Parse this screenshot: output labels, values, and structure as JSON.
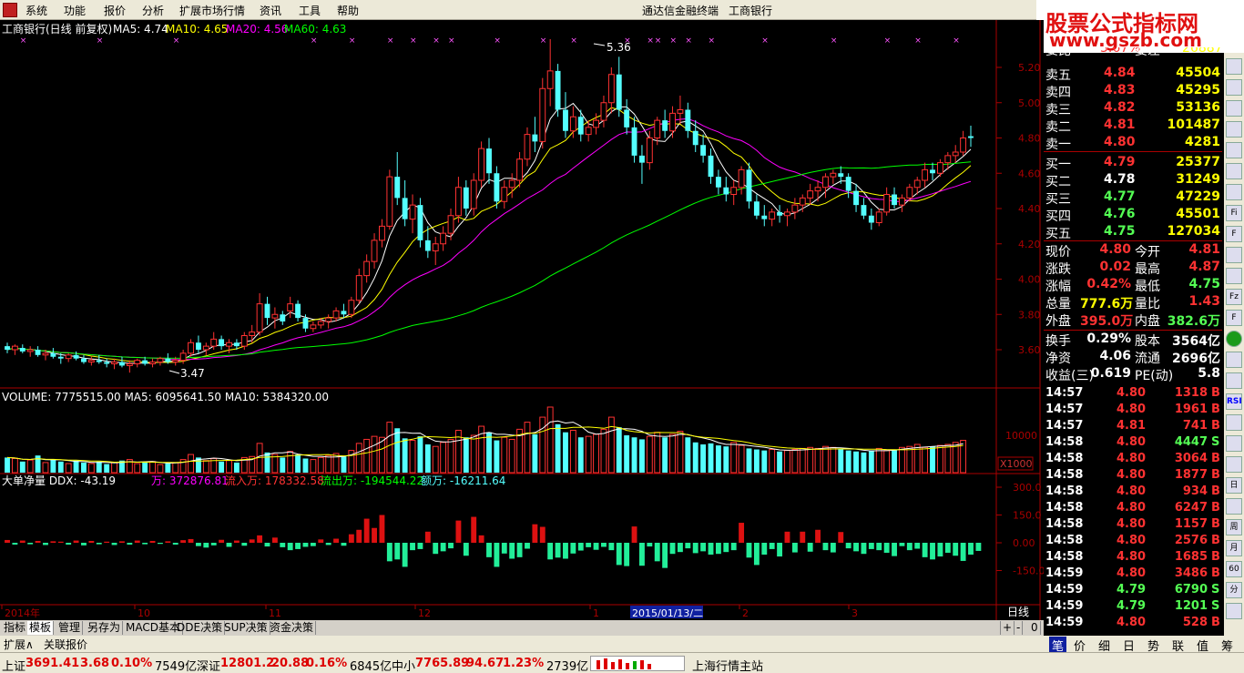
{
  "menu": {
    "items": [
      "系统",
      "功能",
      "报价",
      "分析",
      "扩展市场行情",
      "资讯",
      "工具",
      "帮助"
    ],
    "window_title": "通达信金融终端",
    "stock_title": "工商银行"
  },
  "logo": {
    "line1": "股票公式指标网",
    "line2": "www.gszb.com"
  },
  "colors": {
    "up": "#ff3232",
    "down": "#54ffff",
    "ma5": "#ffffff",
    "ma10": "#ffff00",
    "ma20": "#ff00ff",
    "ma60": "#00ff00",
    "axis": "#aa0000"
  },
  "main_panel": {
    "label_name": "工商银行(日线 前复权)",
    "ma5": "MA5: 4.74",
    "ma10": "MA10: 4.65",
    "ma20": "MA20: 4.56",
    "ma60": "MA60: 4.63",
    "high_note": "5.36",
    "low_note": "3.47",
    "y_ticks": [
      "5.20",
      "5.00",
      "4.80",
      "4.60",
      "4.40",
      "4.20",
      "4.00",
      "3.80",
      "3.60"
    ]
  },
  "volume_panel": {
    "label": "VOLUME: 7775515.00  MA5: 6095641.50  MA10: 5384320.00",
    "y_tick": "10000",
    "unit": "X1000"
  },
  "ddx_panel": {
    "label": "大单净量  DDX: -43.19",
    "extra_wan": "万: 372876.81",
    "extra_in": "流入万: 178332.58",
    "extra_out": "流出万: -194544.22",
    "extra_net": "额万: -16211.64",
    "y_ticks": [
      "300.0",
      "150.0",
      "0.00",
      "-150.0"
    ]
  },
  "x_axis": {
    "labels": [
      "2014年",
      "10",
      "11",
      "12",
      "1",
      "2",
      "3"
    ],
    "cursor_date": "2015/01/13/二",
    "period": "日线"
  },
  "quote": {
    "top_partial": [
      "委比",
      "3.67%",
      "委差",
      "26887"
    ],
    "asks": [
      {
        "label": "卖五",
        "price": "4.84",
        "vol": "45504"
      },
      {
        "label": "卖四",
        "price": "4.83",
        "vol": "45295"
      },
      {
        "label": "卖三",
        "price": "4.82",
        "vol": "53136"
      },
      {
        "label": "卖二",
        "price": "4.81",
        "vol": "101487"
      },
      {
        "label": "卖一",
        "price": "4.80",
        "vol": "4281"
      }
    ],
    "bids": [
      {
        "label": "买一",
        "price": "4.79",
        "vol": "25377"
      },
      {
        "label": "买二",
        "price": "4.78",
        "vol": "31249"
      },
      {
        "label": "买三",
        "price": "4.77",
        "vol": "47229"
      },
      {
        "label": "买四",
        "price": "4.76",
        "vol": "45501"
      },
      {
        "label": "买五",
        "price": "4.75",
        "vol": "127034"
      }
    ],
    "stats": [
      {
        "l1": "现价",
        "v1": "4.80",
        "l2": "今开",
        "v2": "4.81"
      },
      {
        "l1": "涨跌",
        "v1": "0.02",
        "l2": "最高",
        "v2": "4.87"
      },
      {
        "l1": "涨幅",
        "v1": "0.42%",
        "l2": "最低",
        "v2": "4.75"
      },
      {
        "l1": "总量",
        "v1": "777.6万",
        "l2": "量比",
        "v2": "1.43"
      },
      {
        "l1": "外盘",
        "v1": "395.0万",
        "l2": "内盘",
        "v2": "382.6万"
      }
    ],
    "stats2": [
      {
        "l1": "换手",
        "v1": "0.29%",
        "l2": "股本",
        "v2": "3564亿"
      },
      {
        "l1": "净资",
        "v1": "4.06",
        "l2": "流通",
        "v2": "2696亿"
      },
      {
        "l1": "收益(三)",
        "v1": "0.619",
        "l2": "PE(动)",
        "v2": "5.8"
      }
    ]
  },
  "ticks": [
    {
      "t": "14:57",
      "p": "4.80",
      "v": "1318",
      "d": "B"
    },
    {
      "t": "14:57",
      "p": "4.80",
      "v": "1961",
      "d": "B"
    },
    {
      "t": "14:57",
      "p": "4.81",
      "v": "741",
      "d": "B"
    },
    {
      "t": "14:58",
      "p": "4.80",
      "v": "4447",
      "d": "S"
    },
    {
      "t": "14:58",
      "p": "4.80",
      "v": "3064",
      "d": "B"
    },
    {
      "t": "14:58",
      "p": "4.80",
      "v": "1877",
      "d": "B"
    },
    {
      "t": "14:58",
      "p": "4.80",
      "v": "934",
      "d": "B"
    },
    {
      "t": "14:58",
      "p": "4.80",
      "v": "6247",
      "d": "B"
    },
    {
      "t": "14:58",
      "p": "4.80",
      "v": "1157",
      "d": "B"
    },
    {
      "t": "14:58",
      "p": "4.80",
      "v": "2576",
      "d": "B"
    },
    {
      "t": "14:58",
      "p": "4.80",
      "v": "1685",
      "d": "B"
    },
    {
      "t": "14:59",
      "p": "4.80",
      "v": "3486",
      "d": "B"
    },
    {
      "t": "14:59",
      "p": "4.79",
      "v": "6790",
      "d": "S"
    },
    {
      "t": "14:59",
      "p": "4.79",
      "v": "1201",
      "d": "S"
    },
    {
      "t": "14:59",
      "p": "4.80",
      "v": "528",
      "d": "B"
    }
  ],
  "right_toolbar": [
    "RSI"
  ],
  "bottom_tabs": [
    "指标",
    "模板",
    "管理",
    "另存为",
    "MACD基本",
    "DDE决策",
    "SUP决策",
    "资金决策"
  ],
  "bottom_right_ctrl": [
    "+",
    "-",
    "0"
  ],
  "ext_bar": {
    "a": "扩展∧",
    "b": "关联报价"
  },
  "right_tabs": [
    "笔",
    "价",
    "细",
    "日",
    "势",
    "联",
    "值",
    "筹"
  ],
  "status": {
    "sh_name": "上证",
    "sh_val": "3691.41",
    "sh_chg": "3.68",
    "sh_pct": "0.10%",
    "sh_amt": "7549亿",
    "sz_name": "深证",
    "sz_val": "12801.2",
    "sz_chg": "20.88",
    "sz_pct": "0.16%",
    "sz_amt": "6845亿",
    "zx_name": "中小",
    "zx_val": "7765.89",
    "zx_chg": "94.67",
    "zx_pct": "1.23%",
    "zx_amt": "2739亿",
    "server": "上海行情主站"
  },
  "chart_data": {
    "type": "candlestick",
    "title": "工商银行(日线 前复权)",
    "y_range": [
      3.47,
      5.36
    ],
    "candles": [
      [
        3.62,
        3.64,
        3.58,
        3.6
      ],
      [
        3.6,
        3.63,
        3.57,
        3.62
      ],
      [
        3.61,
        3.63,
        3.58,
        3.59
      ],
      [
        3.59,
        3.62,
        3.56,
        3.6
      ],
      [
        3.6,
        3.62,
        3.56,
        3.57
      ],
      [
        3.57,
        3.6,
        3.54,
        3.58
      ],
      [
        3.58,
        3.61,
        3.55,
        3.56
      ],
      [
        3.56,
        3.58,
        3.52,
        3.55
      ],
      [
        3.55,
        3.58,
        3.53,
        3.57
      ],
      [
        3.57,
        3.59,
        3.54,
        3.55
      ],
      [
        3.55,
        3.57,
        3.52,
        3.53
      ],
      [
        3.53,
        3.56,
        3.51,
        3.54
      ],
      [
        3.54,
        3.57,
        3.52,
        3.53
      ],
      [
        3.53,
        3.55,
        3.5,
        3.52
      ],
      [
        3.52,
        3.55,
        3.49,
        3.53
      ],
      [
        3.53,
        3.56,
        3.5,
        3.51
      ],
      [
        3.51,
        3.54,
        3.47,
        3.52
      ],
      [
        3.52,
        3.55,
        3.5,
        3.54
      ],
      [
        3.54,
        3.56,
        3.51,
        3.52
      ],
      [
        3.52,
        3.55,
        3.5,
        3.53
      ],
      [
        3.53,
        3.56,
        3.51,
        3.55
      ],
      [
        3.55,
        3.58,
        3.52,
        3.53
      ],
      [
        3.53,
        3.56,
        3.51,
        3.54
      ],
      [
        3.54,
        3.6,
        3.52,
        3.58
      ],
      [
        3.58,
        3.66,
        3.56,
        3.64
      ],
      [
        3.64,
        3.68,
        3.58,
        3.6
      ],
      [
        3.6,
        3.64,
        3.57,
        3.62
      ],
      [
        3.62,
        3.7,
        3.6,
        3.66
      ],
      [
        3.66,
        3.68,
        3.6,
        3.62
      ],
      [
        3.62,
        3.66,
        3.58,
        3.64
      ],
      [
        3.64,
        3.66,
        3.6,
        3.62
      ],
      [
        3.62,
        3.7,
        3.6,
        3.68
      ],
      [
        3.68,
        3.74,
        3.64,
        3.7
      ],
      [
        3.7,
        3.92,
        3.68,
        3.86
      ],
      [
        3.86,
        3.9,
        3.74,
        3.78
      ],
      [
        3.78,
        3.84,
        3.72,
        3.8
      ],
      [
        3.8,
        3.82,
        3.74,
        3.76
      ],
      [
        3.82,
        3.9,
        3.78,
        3.86
      ],
      [
        3.86,
        3.88,
        3.76,
        3.78
      ],
      [
        3.78,
        3.8,
        3.7,
        3.72
      ],
      [
        3.72,
        3.76,
        3.7,
        3.74
      ],
      [
        3.74,
        3.78,
        3.72,
        3.76
      ],
      [
        3.76,
        3.8,
        3.72,
        3.78
      ],
      [
        3.78,
        3.84,
        3.76,
        3.82
      ],
      [
        3.82,
        3.86,
        3.78,
        3.8
      ],
      [
        3.8,
        3.9,
        3.78,
        3.88
      ],
      [
        3.88,
        4.06,
        3.86,
        4.02
      ],
      [
        4.02,
        4.14,
        3.98,
        4.1
      ],
      [
        4.1,
        4.26,
        4.06,
        4.22
      ],
      [
        4.22,
        4.34,
        4.18,
        4.3
      ],
      [
        4.3,
        4.62,
        4.28,
        4.58
      ],
      [
        4.58,
        4.72,
        4.42,
        4.46
      ],
      [
        4.46,
        4.56,
        4.3,
        4.34
      ],
      [
        4.34,
        4.48,
        4.26,
        4.42
      ],
      [
        4.42,
        4.46,
        4.18,
        4.22
      ],
      [
        4.22,
        4.3,
        4.12,
        4.16
      ],
      [
        4.16,
        4.24,
        4.08,
        4.2
      ],
      [
        4.2,
        4.3,
        4.16,
        4.26
      ],
      [
        4.26,
        4.4,
        4.22,
        4.36
      ],
      [
        4.36,
        4.58,
        4.32,
        4.52
      ],
      [
        4.52,
        4.56,
        4.36,
        4.4
      ],
      [
        4.4,
        4.6,
        4.36,
        4.56
      ],
      [
        4.56,
        4.78,
        4.52,
        4.74
      ],
      [
        4.74,
        4.8,
        4.54,
        4.6
      ],
      [
        4.6,
        4.64,
        4.4,
        4.44
      ],
      [
        4.44,
        4.56,
        4.4,
        4.52
      ],
      [
        4.52,
        4.6,
        4.46,
        4.56
      ],
      [
        4.56,
        4.72,
        4.52,
        4.68
      ],
      [
        4.68,
        4.86,
        4.64,
        4.82
      ],
      [
        4.82,
        4.92,
        4.72,
        4.78
      ],
      [
        4.78,
        5.14,
        4.74,
        5.08
      ],
      [
        5.08,
        5.36,
        4.98,
        5.18
      ],
      [
        5.18,
        5.22,
        4.92,
        4.96
      ],
      [
        4.96,
        5.06,
        4.8,
        4.84
      ],
      [
        4.84,
        4.98,
        4.8,
        4.92
      ],
      [
        4.92,
        4.96,
        4.78,
        4.82
      ],
      [
        4.82,
        4.9,
        4.78,
        4.86
      ],
      [
        4.86,
        4.94,
        4.82,
        4.9
      ],
      [
        4.9,
        5.04,
        4.86,
        5.0
      ],
      [
        5.0,
        5.2,
        4.94,
        5.16
      ],
      [
        5.16,
        5.26,
        4.92,
        4.96
      ],
      [
        4.96,
        5.02,
        4.82,
        4.86
      ],
      [
        4.86,
        4.92,
        4.66,
        4.7
      ],
      [
        4.7,
        4.76,
        4.54,
        4.66
      ],
      [
        4.66,
        4.84,
        4.62,
        4.8
      ],
      [
        4.8,
        4.92,
        4.76,
        4.9
      ],
      [
        4.9,
        4.96,
        4.8,
        4.84
      ],
      [
        4.84,
        4.98,
        4.8,
        4.94
      ],
      [
        4.94,
        5.04,
        4.88,
        4.96
      ],
      [
        4.96,
        5.0,
        4.8,
        4.84
      ],
      [
        4.84,
        4.9,
        4.72,
        4.76
      ],
      [
        4.76,
        4.82,
        4.66,
        4.7
      ],
      [
        4.7,
        4.74,
        4.54,
        4.58
      ],
      [
        4.58,
        4.62,
        4.48,
        4.52
      ],
      [
        4.52,
        4.58,
        4.44,
        4.48
      ],
      [
        4.48,
        4.56,
        4.42,
        4.52
      ],
      [
        4.52,
        4.64,
        4.48,
        4.62
      ],
      [
        4.62,
        4.66,
        4.4,
        4.44
      ],
      [
        4.44,
        4.48,
        4.34,
        4.36
      ],
      [
        4.36,
        4.42,
        4.3,
        4.34
      ],
      [
        4.34,
        4.4,
        4.3,
        4.38
      ],
      [
        4.38,
        4.42,
        4.32,
        4.36
      ],
      [
        4.36,
        4.4,
        4.3,
        4.38
      ],
      [
        4.38,
        4.46,
        4.34,
        4.42
      ],
      [
        4.42,
        4.48,
        4.38,
        4.46
      ],
      [
        4.46,
        4.54,
        4.42,
        4.5
      ],
      [
        4.5,
        4.56,
        4.44,
        4.52
      ],
      [
        4.52,
        4.6,
        4.46,
        4.58
      ],
      [
        4.58,
        4.62,
        4.54,
        4.6
      ],
      [
        4.6,
        4.64,
        4.54,
        4.58
      ],
      [
        4.58,
        4.6,
        4.46,
        4.5
      ],
      [
        4.5,
        4.54,
        4.38,
        4.42
      ],
      [
        4.42,
        4.46,
        4.34,
        4.36
      ],
      [
        4.36,
        4.4,
        4.28,
        4.32
      ],
      [
        4.32,
        4.4,
        4.3,
        4.38
      ],
      [
        4.38,
        4.52,
        4.36,
        4.48
      ],
      [
        4.48,
        4.52,
        4.4,
        4.42
      ],
      [
        4.42,
        4.48,
        4.38,
        4.46
      ],
      [
        4.46,
        4.54,
        4.44,
        4.52
      ],
      [
        4.52,
        4.58,
        4.48,
        4.56
      ],
      [
        4.56,
        4.66,
        4.52,
        4.62
      ],
      [
        4.62,
        4.66,
        4.56,
        4.6
      ],
      [
        4.6,
        4.68,
        4.58,
        4.66
      ],
      [
        4.66,
        4.72,
        4.62,
        4.7
      ],
      [
        4.7,
        4.76,
        4.66,
        4.72
      ],
      [
        4.72,
        4.84,
        4.7,
        4.8
      ],
      [
        4.81,
        4.87,
        4.75,
        4.8
      ]
    ],
    "volume": [
      30,
      28,
      22,
      25,
      34,
      20,
      26,
      22,
      18,
      24,
      20,
      18,
      22,
      17,
      20,
      24,
      26,
      18,
      20,
      22,
      16,
      18,
      20,
      26,
      36,
      30,
      24,
      28,
      22,
      24,
      20,
      30,
      32,
      58,
      40,
      36,
      30,
      42,
      36,
      28,
      26,
      30,
      34,
      38,
      32,
      44,
      58,
      66,
      72,
      70,
      100,
      88,
      68,
      64,
      72,
      56,
      52,
      60,
      66,
      84,
      70,
      74,
      92,
      80,
      64,
      70,
      66,
      86,
      100,
      76,
      110,
      130,
      96,
      80,
      84,
      70,
      72,
      76,
      86,
      110,
      90,
      74,
      70,
      66,
      72,
      80,
      70,
      76,
      82,
      70,
      60,
      56,
      58,
      54,
      52,
      60,
      54,
      48,
      46,
      44,
      46,
      42,
      44,
      46,
      48,
      50,
      48,
      52,
      50,
      46,
      44,
      42,
      40,
      44,
      48,
      44,
      46,
      50,
      52,
      56,
      50,
      52,
      54,
      56,
      60,
      64
    ],
    "ddx": [
      15,
      -10,
      12,
      -8,
      10,
      -12,
      8,
      6,
      -10,
      12,
      -14,
      10,
      -8,
      6,
      -12,
      8,
      -10,
      12,
      -8,
      10,
      -6,
      8,
      -10,
      14,
      20,
      -18,
      -26,
      -14,
      16,
      -22,
      12,
      -16,
      18,
      40,
      -20,
      28,
      -24,
      -40,
      -34,
      -22,
      -18,
      18,
      -12,
      22,
      -16,
      46,
      70,
      130,
      80,
      150,
      -100,
      -90,
      -130,
      -40,
      -34,
      60,
      -60,
      -46,
      -30,
      120,
      -70,
      140,
      40,
      -78,
      -130,
      -58,
      -86,
      -78,
      -32,
      100,
      86,
      -90,
      -80,
      -86,
      -58,
      -42,
      -24,
      -38,
      -22,
      -40,
      -120,
      -126,
      88,
      -124,
      -20,
      -100,
      -136,
      -60,
      -50,
      -30,
      -56,
      -46,
      -64,
      -60,
      -50,
      -40,
      108,
      -80,
      -120,
      -64,
      -34,
      -74,
      60,
      -52,
      60,
      -48,
      70,
      -40,
      -52,
      58,
      -30,
      -46,
      -60,
      -34,
      -40,
      -54,
      -72,
      -18,
      -40,
      -32,
      -78,
      -90,
      -74,
      -54,
      -70,
      -98,
      -64,
      -44
    ]
  }
}
